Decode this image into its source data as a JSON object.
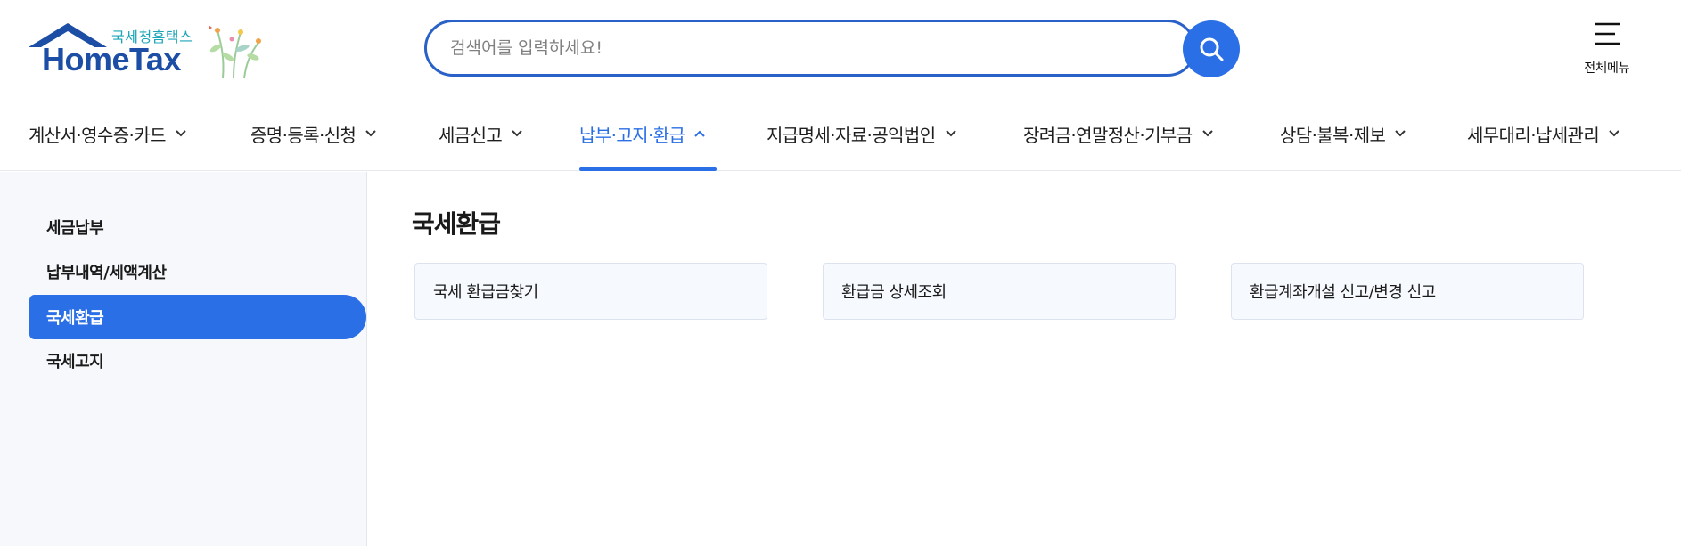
{
  "header": {
    "logo_sub": "국세청홈택스",
    "logo_main": "HomeTax",
    "search_placeholder": "검색어를 입력하세요!",
    "all_menu_label": "전체메뉴",
    "accent_color": "#2a6fe6"
  },
  "nav": {
    "items": [
      {
        "label": "계산서·영수증·카드",
        "icon": "chevron-down-icon"
      },
      {
        "label": "증명·등록·신청",
        "icon": "chevron-down-icon"
      },
      {
        "label": "세금신고",
        "icon": "chevron-down-icon"
      },
      {
        "label": "납부·고지·환급",
        "icon": "chevron-up-icon",
        "active": true
      },
      {
        "label": "지급명세·자료·공익법인",
        "icon": "chevron-down-icon"
      },
      {
        "label": "장려금·연말정산·기부금",
        "icon": "chevron-down-icon"
      },
      {
        "label": "상담·불복·제보",
        "icon": "chevron-down-icon"
      },
      {
        "label": "세무대리·납세관리",
        "icon": "chevron-down-icon"
      }
    ]
  },
  "sidebar": {
    "items": [
      {
        "label": "세금납부"
      },
      {
        "label": "납부내역/세액계산"
      },
      {
        "label": "국세환급",
        "active": true
      },
      {
        "label": "국세고지"
      }
    ]
  },
  "main": {
    "title": "국세환급",
    "cards": [
      {
        "label": "국세 환급금찾기"
      },
      {
        "label": "환급금 상세조회"
      },
      {
        "label": "환급계좌개설 신고/변경 신고"
      }
    ]
  }
}
